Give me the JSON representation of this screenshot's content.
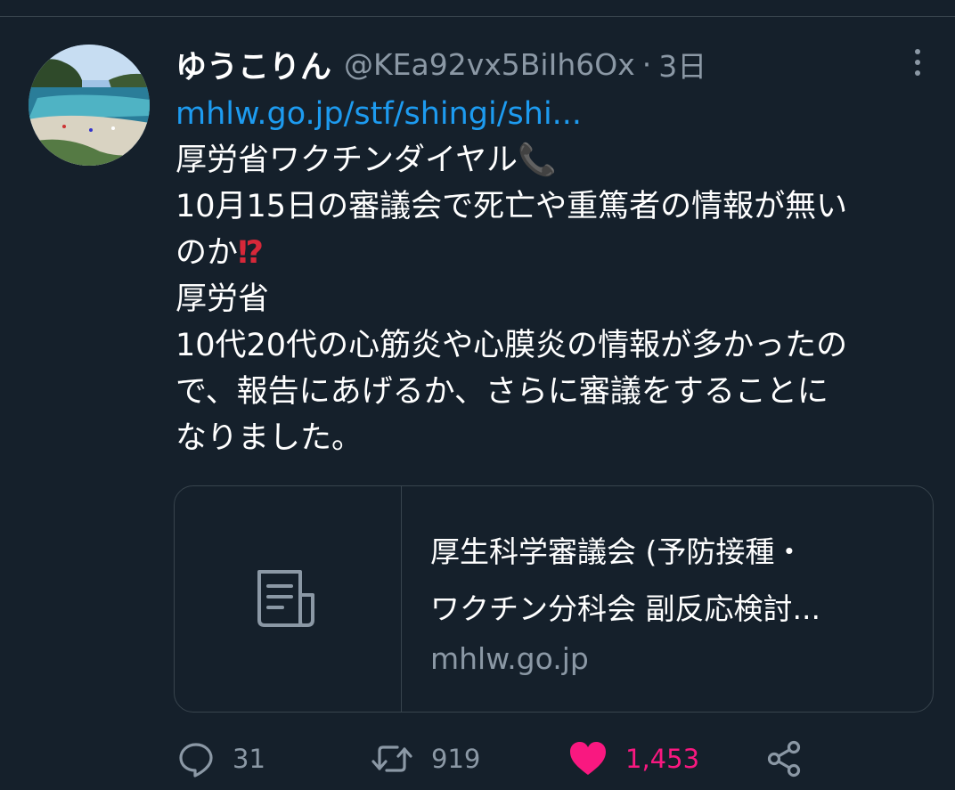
{
  "tweet": {
    "display_name": "ゆうこりん",
    "handle": "@KEa92vx5BiIh6Ox",
    "separator": "·",
    "time": "3日",
    "link_text": "mhlw.go.jp/stf/shingi/shi...",
    "lines": [
      "厚労省ワクチンダイヤル",
      "10月15日の審議会で死亡や重篤者の情報が無い",
      "のか",
      "厚労省",
      "10代20代の心筋炎や心膜炎の情報が多かったの",
      "で、報告にあげるか、さらに審議をすることに",
      "なりました。"
    ],
    "emoji_phone": "📞",
    "emoji_exclamation_question": "⁉"
  },
  "card": {
    "title_line1": "厚生科学審議会 (予防接種・",
    "title_line2": "ワクチン分科会 副反応検討...",
    "domain": "mhlw.go.jp",
    "icon": "document-icon"
  },
  "actions": {
    "reply_count": "31",
    "retweet_count": "919",
    "like_count": "1,453"
  },
  "colors": {
    "background": "#15202b",
    "link": "#1d9bf0",
    "muted": "#8b98a5",
    "like": "#f91880",
    "border": "#38444d"
  }
}
